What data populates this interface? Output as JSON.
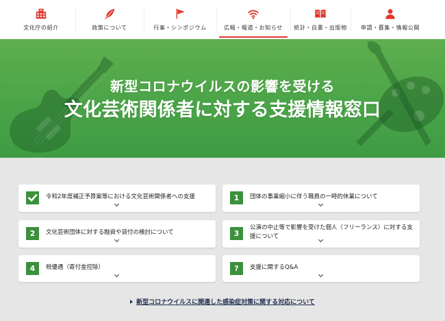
{
  "nav": {
    "items": [
      {
        "label": "文化庁の紹介",
        "icon": "building-icon",
        "active": false
      },
      {
        "label": "政策について",
        "icon": "quill-icon",
        "active": false
      },
      {
        "label": "行事・シンポジウム",
        "icon": "flag-icon",
        "active": false
      },
      {
        "label": "広報・報道・お知らせ",
        "icon": "broadcast-icon",
        "active": true
      },
      {
        "label": "統計・白書・出版物",
        "icon": "book-icon",
        "active": false
      },
      {
        "label": "申請・募集・情報公開",
        "icon": "person-icon",
        "active": false
      }
    ]
  },
  "hero": {
    "subtitle": "新型コロナウイルスの影響を受ける",
    "title": "文化芸術関係者に対する支援情報窓口",
    "illustrations": [
      "guitar-illustration",
      "palette-brush-illustration"
    ]
  },
  "cards": [
    {
      "icon": "check-icon",
      "text": "令和2年度補正予算案等における文化芸術関係者への支援"
    },
    {
      "badge": "1",
      "text": "団体の事業縮小に伴う職員の一時的休業について"
    },
    {
      "badge": "2",
      "text": "文化芸術団体に対する融資や貸付の検討について"
    },
    {
      "badge": "3",
      "text": "公演の中止等で影響を受けた個人（フリーランス）に対する支援について"
    },
    {
      "badge": "4",
      "text": "税優遇（寄付金控除）"
    },
    {
      "badge": "?",
      "text": "支援に関するQ&A"
    }
  ],
  "footer_link": {
    "icon": "arrow-right-icon",
    "text": "新型コロナウイルスに関連した感染症対策に関する対応について"
  },
  "colors": {
    "accent_red": "#e0352d",
    "hero_green": "#4fa647",
    "badge_green": "#3c903c",
    "link_navy": "#1f2d4f",
    "background_gray": "#e6e6e6"
  }
}
